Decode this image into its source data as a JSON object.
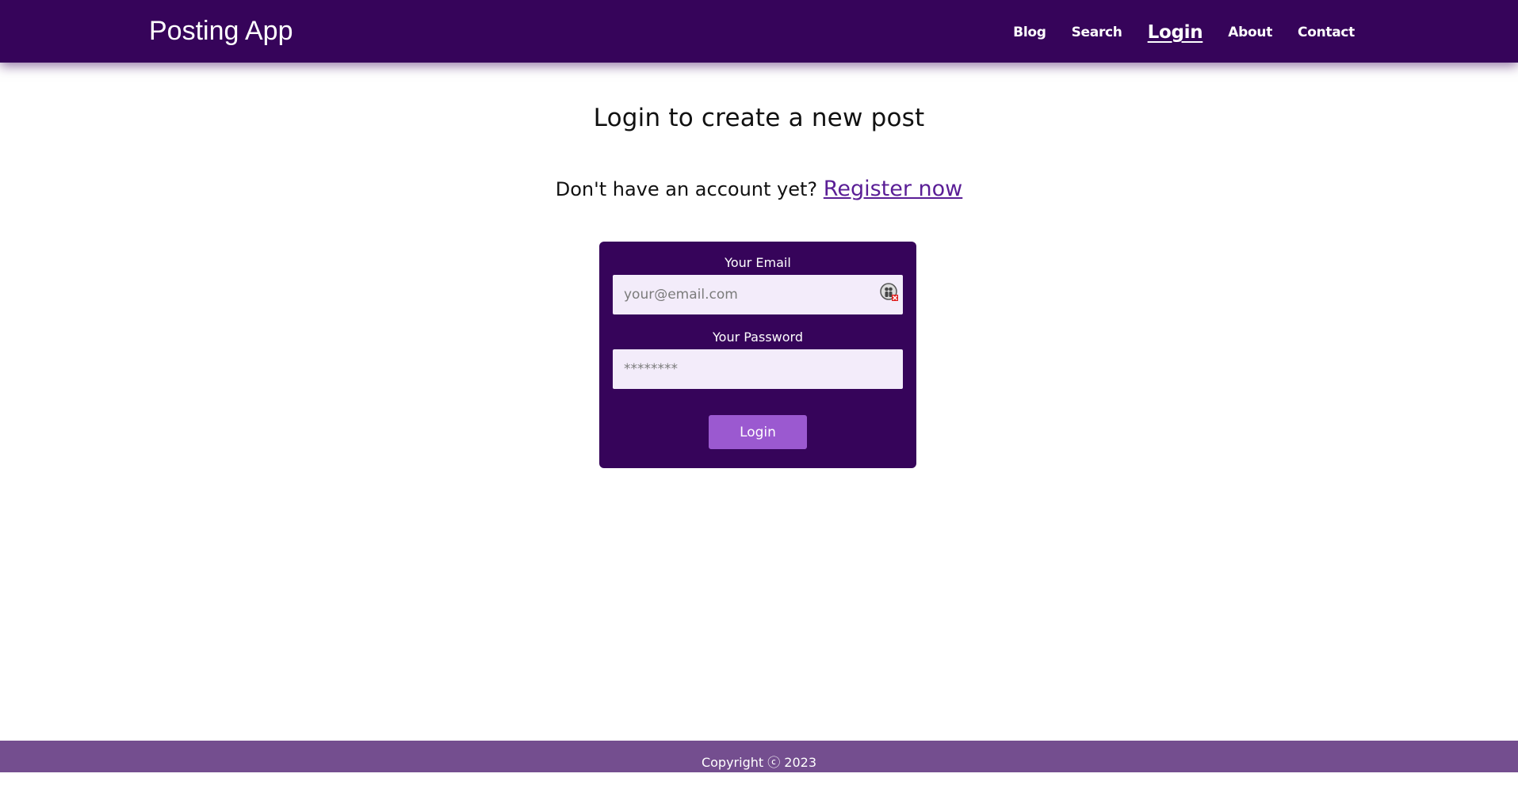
{
  "header": {
    "brand": "Posting App",
    "nav": [
      {
        "label": "Blog"
      },
      {
        "label": "Search"
      },
      {
        "label": "Login",
        "active": true
      },
      {
        "label": "About"
      },
      {
        "label": "Contact"
      }
    ]
  },
  "main": {
    "title": "Login to create a new post",
    "register_prompt": "Don't have an account yet?",
    "register_link": "Register now"
  },
  "form": {
    "email_label": "Your Email",
    "email_placeholder": "your@email.com",
    "email_value": "",
    "password_label": "Your Password",
    "password_placeholder": "********",
    "password_value": "",
    "submit_label": "Login"
  },
  "footer": {
    "copyright": "Copyright ⓒ 2023"
  },
  "colors": {
    "primary": "#36045a",
    "button": "#9b59d0",
    "input_bg": "#f3ecfa",
    "footer": "#744e8f",
    "link": "#5a1e96"
  },
  "icons": {
    "autofill": "password-manager-icon"
  }
}
